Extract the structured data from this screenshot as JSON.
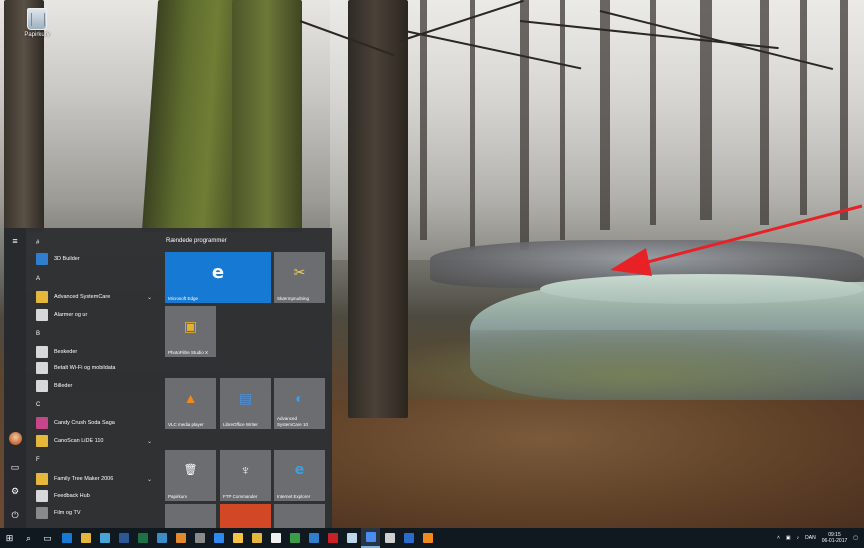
{
  "desktop": {
    "icons": [
      {
        "label": "Papirkurv",
        "icon": "recycle-bin-icon"
      }
    ]
  },
  "start_menu": {
    "rail": [
      {
        "icon": "hamburger-icon"
      },
      {
        "icon": "user-avatar-icon"
      },
      {
        "icon": "documents-icon"
      },
      {
        "icon": "settings-icon"
      },
      {
        "icon": "power-icon"
      }
    ],
    "apps": [
      {
        "kind": "letter",
        "label": "#"
      },
      {
        "kind": "app",
        "label": "3D Builder",
        "icon": "3d-builder-icon",
        "color": "#2f7fce"
      },
      {
        "kind": "letter",
        "label": "A"
      },
      {
        "kind": "app",
        "label": "Advanced SystemCare",
        "icon": "folder-icon",
        "color": "#e5b83c",
        "chevron": true
      },
      {
        "kind": "app",
        "label": "Alarmer og ur",
        "icon": "alarm-icon",
        "color": "#d8d8d8"
      },
      {
        "kind": "letter",
        "label": "B"
      },
      {
        "kind": "app",
        "label": "Beskeder",
        "icon": "messages-icon",
        "color": "#d8d8d8"
      },
      {
        "kind": "app",
        "label": "Betalt Wi-Fi og mobildata",
        "icon": "wifi-icon",
        "color": "#d8d8d8"
      },
      {
        "kind": "app",
        "label": "Billeder",
        "icon": "photos-icon",
        "color": "#d8d8d8"
      },
      {
        "kind": "letter",
        "label": "C"
      },
      {
        "kind": "app",
        "label": "Candy Crush Soda Saga",
        "icon": "candy-crush-icon",
        "color": "#c7458b"
      },
      {
        "kind": "app",
        "label": "CanoScan LiDE 110",
        "icon": "folder-icon",
        "color": "#e5b83c",
        "chevron": true
      },
      {
        "kind": "letter",
        "label": "F"
      },
      {
        "kind": "app",
        "label": "Family Tree Maker 2006",
        "icon": "folder-icon",
        "color": "#e5b83c",
        "chevron": true
      },
      {
        "kind": "app",
        "label": "Feedback Hub",
        "icon": "feedback-icon",
        "color": "#d8d8d8"
      },
      {
        "kind": "app",
        "label": "Film og TV",
        "icon": "film-icon",
        "color": "#8a8a8a"
      }
    ],
    "tiles_heading": "Rændede programmer",
    "tiles": {
      "edge": {
        "label": "Microsoft Edge",
        "glyph": "e"
      },
      "snip": {
        "label": "Skærmprudning",
        "glyph": "✂"
      },
      "photo": {
        "label": "PhotoFiltre Studio X",
        "glyph": "▣"
      },
      "vlc": {
        "label": "VLC media player",
        "glyph": "▲"
      },
      "lo": {
        "label": "LibreOffice Writer",
        "glyph": "▤"
      },
      "asc": {
        "label": "Advanced SystemCare 10",
        "glyph": "◐"
      },
      "bin": {
        "label": "Papirkurv",
        "glyph": "🗑"
      },
      "ftp": {
        "label": "FTP Commander",
        "glyph": "♆"
      },
      "ie": {
        "label": "Internet Explorer",
        "glyph": "e"
      }
    }
  },
  "taskbar": {
    "start_icon": "windows-start-icon",
    "search_icon": "search-icon",
    "task_view_icon": "task-view-icon",
    "pinned": [
      {
        "name": "edge",
        "color": "#1679d4"
      },
      {
        "name": "explorer",
        "color": "#e5b83c"
      },
      {
        "name": "paint",
        "color": "#46a6d8"
      },
      {
        "name": "word",
        "color": "#2b5797"
      },
      {
        "name": "excel",
        "color": "#1e7145"
      },
      {
        "name": "photos",
        "color": "#3c8dc5"
      },
      {
        "name": "app-orange",
        "color": "#e38a2d"
      },
      {
        "name": "photo-app",
        "color": "#8a8a8a"
      },
      {
        "name": "store",
        "color": "#2d89ef"
      },
      {
        "name": "sticky",
        "color": "#f4c542"
      },
      {
        "name": "folder-2",
        "color": "#e5b83c"
      },
      {
        "name": "doc",
        "color": "#f0f0f0"
      },
      {
        "name": "green-app",
        "color": "#3a9b48"
      },
      {
        "name": "blue-app",
        "color": "#2f7fce"
      },
      {
        "name": "red-app",
        "color": "#cc2027"
      },
      {
        "name": "notepad",
        "color": "#bfd5e8"
      },
      {
        "name": "chrome",
        "color": "#4a8df0"
      },
      {
        "name": "camera",
        "color": "#cfcfcf"
      },
      {
        "name": "browser-2",
        "color": "#2a6ccd"
      },
      {
        "name": "vlc-task",
        "color": "#f08a1c"
      }
    ],
    "tray": {
      "lang": "DAN",
      "time": "09:15",
      "date": "06-01-2017"
    }
  }
}
